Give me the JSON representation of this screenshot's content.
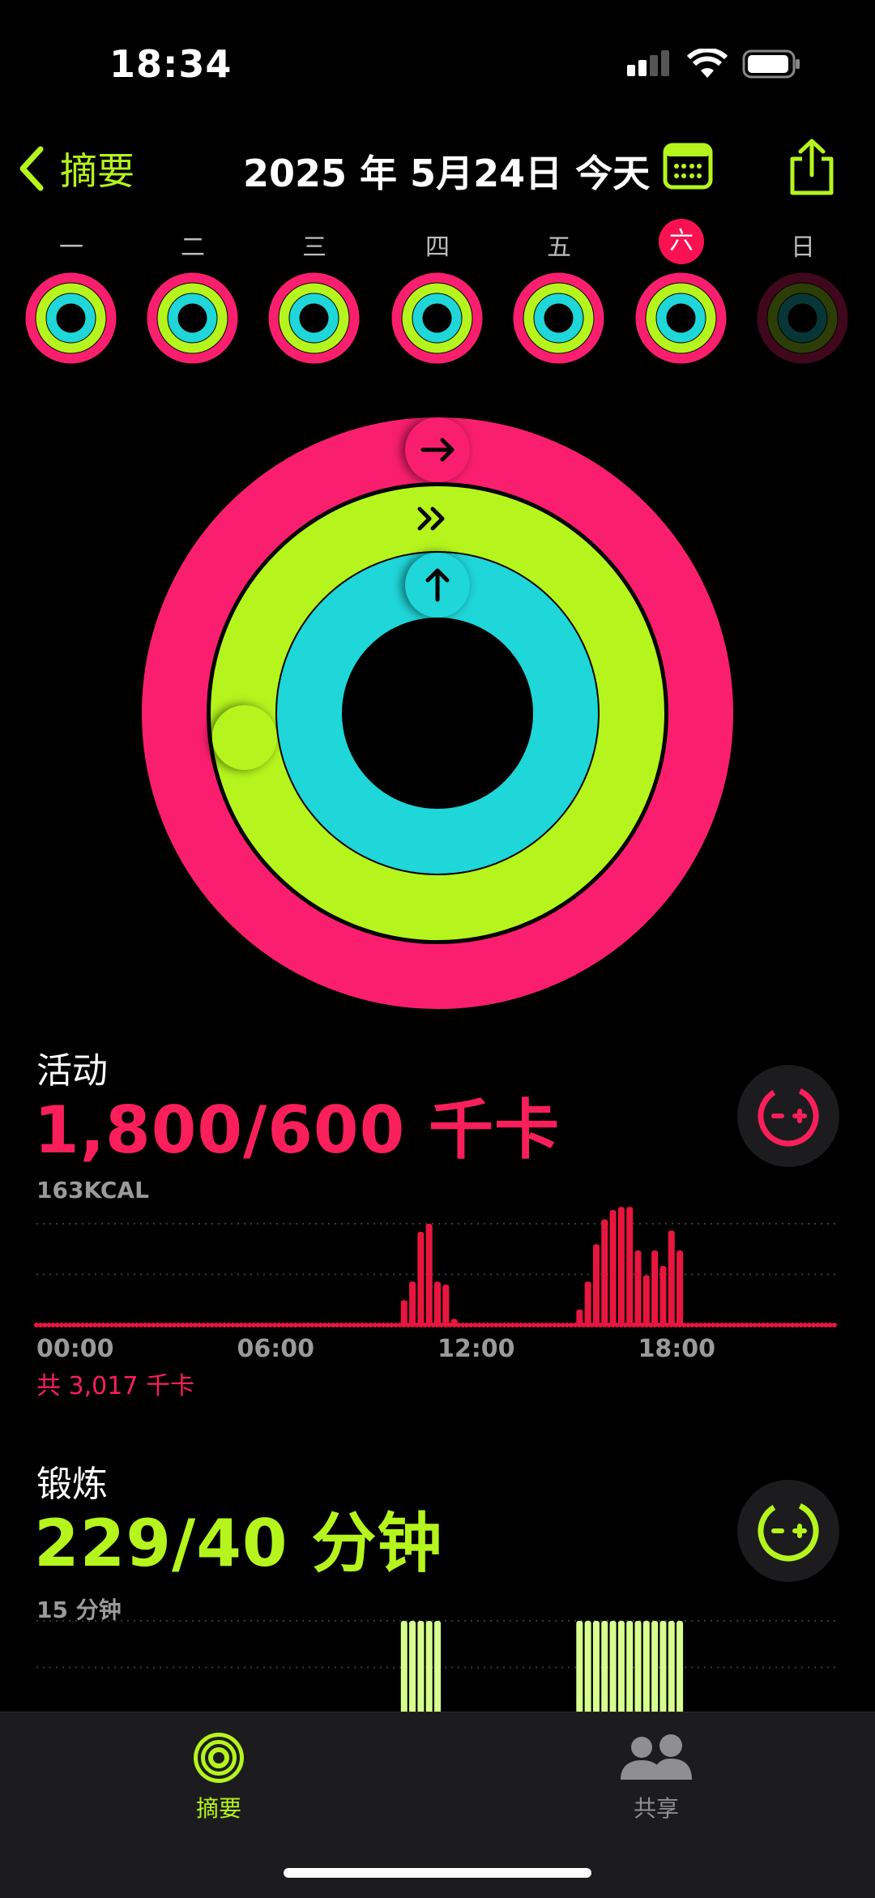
{
  "status": {
    "time": "18:34"
  },
  "header": {
    "back_label": "摘要",
    "title": "2025 年 5月24日 今天"
  },
  "week": {
    "days": [
      "一",
      "二",
      "三",
      "四",
      "五",
      "六",
      "日"
    ],
    "selected_index": 5
  },
  "colors": {
    "move": "#fa1f6e",
    "exercise": "#b5f51d",
    "stand": "#1fd6d9",
    "move_bar": "#e8163f",
    "exercise_bar": "#d7ff8f"
  },
  "rings": {
    "move_progress": 3.0,
    "exercise_progress": 5.73,
    "stand_progress": 1.0
  },
  "activity": {
    "label": "活动",
    "value": "1,800/600 千卡",
    "scale_label": "163KCAL",
    "x_labels": [
      "00:00",
      "06:00",
      "12:00",
      "18:00"
    ],
    "total": "共 3,017 千卡",
    "chart_data": {
      "type": "bar",
      "x_unit": "hour",
      "x": [
        11.0,
        11.25,
        11.5,
        11.75,
        12.0,
        12.25,
        12.5,
        16.25,
        16.5,
        16.75,
        17.0,
        17.25,
        17.5,
        17.75,
        18.0,
        18.25,
        18.5,
        18.75,
        19.0,
        19.25
      ],
      "values": [
        40,
        70,
        150,
        163,
        70,
        65,
        10,
        25,
        70,
        130,
        170,
        185,
        190,
        190,
        120,
        80,
        120,
        95,
        152,
        120
      ],
      "ymax": 163
    }
  },
  "exercise": {
    "label": "锻炼",
    "value": "229/40 分钟",
    "scale_label": "15 分钟",
    "chart_data": {
      "type": "bar",
      "x_unit": "hour",
      "x": [
        11.0,
        11.25,
        11.5,
        11.75,
        12.0,
        16.25,
        16.5,
        16.75,
        17.0,
        17.25,
        17.5,
        17.75,
        18.0,
        18.25,
        18.5,
        18.75,
        19.0,
        19.25
      ],
      "values": [
        15,
        15,
        15,
        15,
        15,
        15,
        15,
        15,
        15,
        15,
        15,
        15,
        15,
        15,
        15,
        15,
        15,
        15
      ],
      "ymax": 15
    }
  },
  "tabs": [
    {
      "label": "摘要",
      "active": true
    },
    {
      "label": "共享",
      "active": false
    }
  ]
}
